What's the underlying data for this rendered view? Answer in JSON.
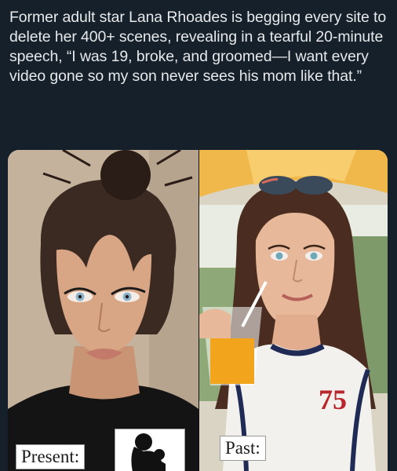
{
  "post": {
    "text": "Former adult star Lana Rhoades is begging every site to delete her 400+ scenes, revealing in a tearful 20-minute speech, “I was 19, broke, and groomed—I want every video gone so my son never sees his mom like that.”"
  },
  "image": {
    "left_label": "Present:",
    "right_label": "Past:",
    "right_shirt_number": "75"
  },
  "icons": {
    "silhouette": "mother-and-child-silhouette-icon"
  },
  "colors": {
    "background": "#15202b",
    "text": "#e7e9ea"
  }
}
